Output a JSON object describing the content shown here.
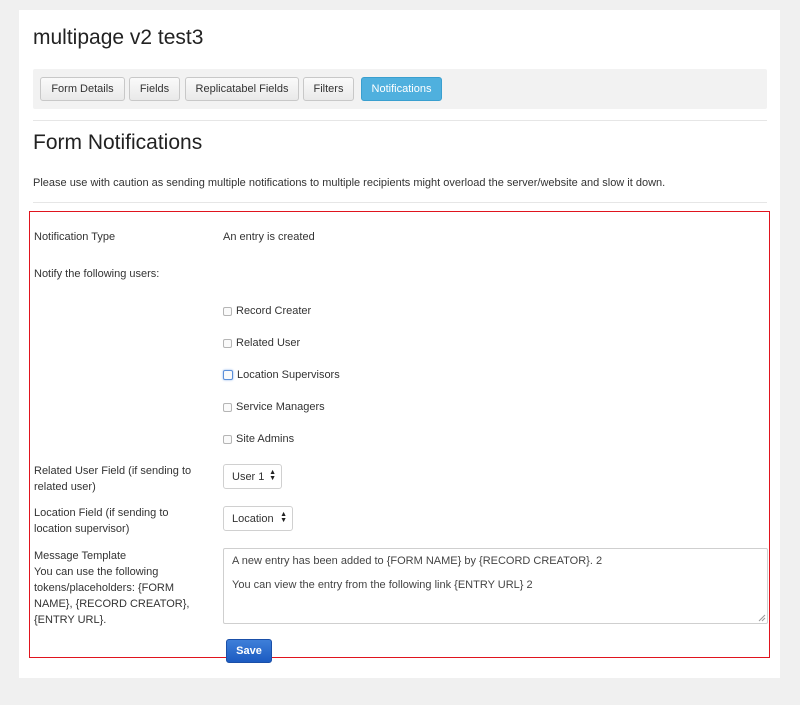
{
  "page": {
    "title": "multipage v2 test3"
  },
  "tabs": [
    {
      "label": "Form Details",
      "active": false
    },
    {
      "label": "Fields",
      "active": false
    },
    {
      "label": "Replicatabel Fields",
      "active": false
    },
    {
      "label": "Filters",
      "active": false
    },
    {
      "label": "Notifications",
      "active": true
    }
  ],
  "section": {
    "title": "Form Notifications",
    "warning": "Please use with caution as sending multiple notifications to multiple recipients might overload the server/website and slow it down."
  },
  "form": {
    "notification_type_label": "Notification Type",
    "notification_type_value": "An entry is created",
    "notify_users_label": "Notify the following users:",
    "recipients": [
      {
        "label": "Record Creater",
        "checked": false
      },
      {
        "label": "Related User",
        "checked": false
      },
      {
        "label": "Location Supervisors",
        "checked": false
      },
      {
        "label": "Service Managers",
        "checked": false
      },
      {
        "label": "Site Admins",
        "checked": false
      }
    ],
    "related_user_field_label": "Related User Field (if sending to related user)",
    "related_user_field_value": "User 1",
    "location_field_label": "Location Field (if sending to location supervisor)",
    "location_field_value": "Location",
    "message_template_label": "Message Template",
    "message_template_help": "You can use the following tokens/placeholders: {FORM NAME}, {RECORD CREATOR}, {ENTRY URL}.",
    "message_template_line1": "A new entry has been added to {FORM NAME} by {RECORD CREATOR}. 2",
    "message_template_line2": "You can view the entry from the following link {ENTRY URL} 2",
    "save_label": "Save"
  },
  "colors": {
    "active_tab": "#4fb0de",
    "save_button": "#2a6bd0",
    "highlight_border": "#e0141e"
  }
}
